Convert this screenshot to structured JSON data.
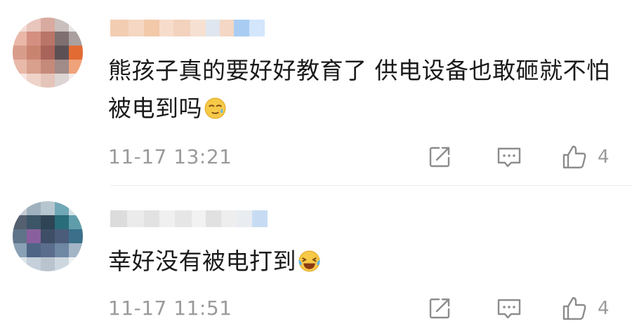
{
  "comments": [
    {
      "text": "熊孩子真的要好好教育了 供电设备也敢砸就不怕被电到吗",
      "emoji": "sweat-emoji",
      "time": "11-17 13:21",
      "likes": "4",
      "avatar_icon": "pixelated-avatar-icon"
    },
    {
      "text": "幸好没有被电打到",
      "emoji": "laughing-tears-emoji",
      "time": "11-17 11:51",
      "likes": "4",
      "avatar_icon": "pixelated-avatar-icon"
    }
  ],
  "icons": {
    "share": "share-icon",
    "reply": "reply-icon",
    "like": "like-icon"
  },
  "colors": {
    "text": "#1a1a1a",
    "meta": "#9a9a9a",
    "icon": "#8c8c8c"
  }
}
